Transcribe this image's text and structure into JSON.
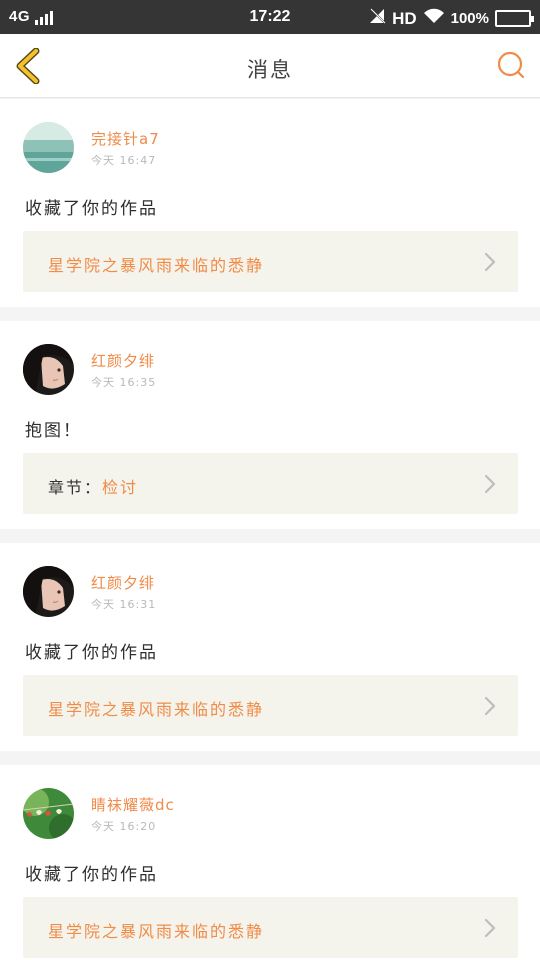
{
  "status_bar": {
    "network": "4G",
    "time": "17:22",
    "hd": "HD",
    "battery": "100%"
  },
  "header": {
    "title": "消息",
    "back_icon": "chevron-left-icon",
    "search_icon": "search-icon"
  },
  "messages": [
    {
      "username": "完接针a7",
      "time": "今天 16:47",
      "text": "收藏了你的作品",
      "link_prefix": "",
      "link_title": "星学院之暴风雨来临的悉静"
    },
    {
      "username": "红颜夕绯",
      "time": "今天 16:35",
      "text": "抱图！",
      "link_prefix": "章节：",
      "link_title": "检讨"
    },
    {
      "username": "红颜夕绯",
      "time": "今天 16:31",
      "text": "收藏了你的作品",
      "link_prefix": "",
      "link_title": "星学院之暴风雨来临的悉静"
    },
    {
      "username": "睛袜耀薇dc",
      "time": "今天 16:20",
      "text": "收藏了你的作品",
      "link_prefix": "",
      "link_title": "星学院之暴风雨来临的悉静"
    }
  ],
  "colors": {
    "accent": "#f08b48",
    "back_arrow": "#f2c230",
    "status_bar": "#353535"
  }
}
